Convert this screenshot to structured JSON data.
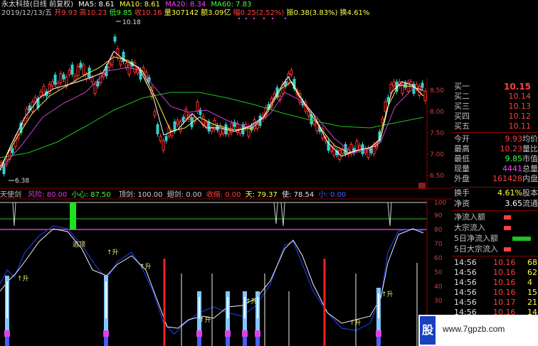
{
  "header": {
    "stock": "永太科技(日线 前复权)",
    "ma5": "MA5: 8.61",
    "ma10": "MA10: 8.61",
    "ma20": "MA20: 8.34",
    "ma60": "MA60: 7.83",
    "date": "2019/12/13/五",
    "open": "开9.93",
    "high": "高10.23",
    "low": "低9.85",
    "close": "收10.16",
    "volume": "量307142",
    "amount": "额3.09亿",
    "range": "幅0.25(2.52%)",
    "amp": "振0.38(3.83%)",
    "turnover": "换4.61%",
    "hi_mark": "10.18",
    "lo_mark": "6.38"
  },
  "price_axis": [
    "8.50",
    "8.00",
    "7.50",
    "7.00",
    "6.50"
  ],
  "indicator": {
    "name": "天使剑",
    "risk": "风险: 80.00",
    "careful": "小心: 87.50",
    "top_sword": "顶剑: 100.00",
    "bottom_sword": "翅剑: 0.00",
    "retreat": "收缩: 0.00",
    "sky": "天: 79.37",
    "angel": "使: 78.54",
    "small": "小: 0.00",
    "axis": [
      "100",
      "90",
      "80",
      "70",
      "60",
      "50",
      "40",
      "30"
    ],
    "annotations": {
      "escape": "逃顶",
      "rise": "↑升"
    }
  },
  "quote": {
    "asks": [
      {
        "label": "买一",
        "price": "10.15"
      },
      {
        "label": "买二",
        "price": "10.14"
      },
      {
        "label": "买三",
        "price": "10.13"
      },
      {
        "label": "买四",
        "price": "10.12"
      },
      {
        "label": "买五",
        "price": "10.11"
      }
    ],
    "stats": [
      {
        "label": "今开",
        "value": "9.93",
        "right": "均价",
        "color": "#ff4040"
      },
      {
        "label": "最高",
        "value": "10.23",
        "right": "量比",
        "color": "#ff4040"
      },
      {
        "label": "最低",
        "value": "9.85",
        "right": "市值",
        "color": "#40ff40"
      },
      {
        "label": "现量",
        "value": "4441",
        "right": "总量",
        "color": "#ff40ff"
      },
      {
        "label": "外盘",
        "value": "161428",
        "right": "内盘",
        "color": "#ff4040"
      }
    ],
    "turnover": {
      "label": "换手",
      "value": "4.61%",
      "right": "股本"
    },
    "netasset": {
      "label": "净资",
      "value": "3.65",
      "right": "流通"
    },
    "flows": [
      {
        "label": "净流入额"
      },
      {
        "label": "大宗流入"
      },
      {
        "label": "5日净流入额"
      },
      {
        "label": "5日大宗流入"
      }
    ],
    "ticks": [
      {
        "time": "14:56",
        "price": "10.16",
        "vol": "68"
      },
      {
        "time": "14:56",
        "price": "10.16",
        "vol": "62"
      },
      {
        "time": "14:56",
        "price": "10.16",
        "vol": "4"
      },
      {
        "time": "14:56",
        "price": "10.16",
        "vol": "15"
      },
      {
        "time": "14:56",
        "price": "10.17",
        "vol": "21"
      },
      {
        "time": "14:56",
        "price": "10.16",
        "vol": "14"
      }
    ]
  },
  "watermark": "www.7gpzb.com",
  "logo_text": "股"
}
